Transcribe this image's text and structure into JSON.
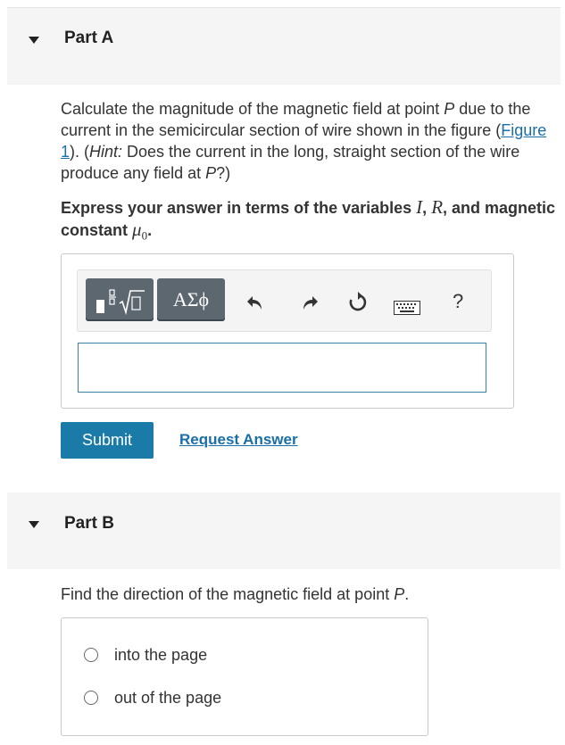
{
  "part_a": {
    "title": "Part A",
    "question_pre": "Calculate the magnitude of the magnetic field at point ",
    "question_P1": "P",
    "question_mid": " due to the current in the semicircular section of wire shown in the figure (",
    "figure_link": "Figure 1",
    "question_after_link": "). (",
    "hint_label": "Hint:",
    "hint_text": " Does the current in the long, straight section of the wire produce any field at ",
    "question_P2": "P",
    "question_end": "?)",
    "instruction_pre": "Express your answer in terms of the variables ",
    "var_I": "I",
    "comma": ", ",
    "var_R": "R",
    "instruction_mid": ", and magnetic constant ",
    "var_mu": "μ",
    "var_mu_sub": "0",
    "instruction_end": ".",
    "toolbar": {
      "templates_icon": "templates-icon",
      "symbols_label": "ΑΣϕ",
      "undo_icon": "undo-icon",
      "redo_icon": "redo-icon",
      "reset_icon": "reset-icon",
      "keyboard_icon": "keyboard-icon",
      "help_label": "?"
    },
    "submit_label": "Submit",
    "request_answer_label": "Request Answer"
  },
  "part_b": {
    "title": "Part B",
    "question_pre": "Find the direction of the magnetic field at point ",
    "question_P": "P",
    "question_end": ".",
    "choices": [
      {
        "label": "into the page"
      },
      {
        "label": "out of the page"
      }
    ]
  },
  "colors": {
    "accent": "#1a7ba8",
    "link": "#1a6fa6",
    "header_bg": "#f5f5f5",
    "toolbar_button": "#5d6770"
  }
}
